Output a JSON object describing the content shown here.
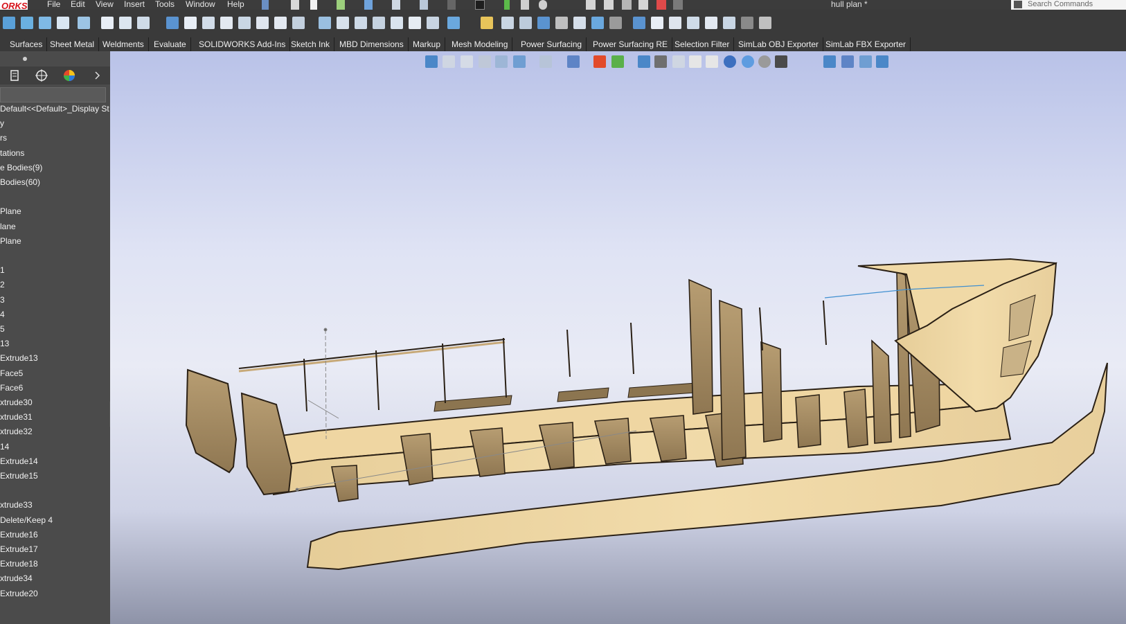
{
  "app": {
    "logo_text": "ORKS",
    "document_title": "hull plan *",
    "search_placeholder": "Search Commands"
  },
  "menu": [
    "File",
    "Edit",
    "View",
    "Insert",
    "Tools",
    "Window",
    "Help"
  ],
  "tabs": [
    "Surfaces",
    "Sheet Metal",
    "Weldments",
    "Evaluate",
    "SOLIDWORKS Add-Ins",
    "Sketch Ink",
    "MBD Dimensions",
    "Markup",
    "Mesh Modeling",
    "Power Surfacing",
    "Power Surfacing RE",
    "Selection Filter",
    "SimLab OBJ Exporter",
    "SimLab FBX Exporter"
  ],
  "feature_tree": [
    "Default<<Default>_Display St",
    "y",
    "rs",
    "tations",
    "e Bodies(9)",
    "Bodies(60)",
    "",
    "Plane",
    "lane",
    "Plane",
    "",
    "1",
    "2",
    "3",
    "4",
    "5",
    "13",
    "Extrude13",
    "Face5",
    "Face6",
    "xtrude30",
    "xtrude31",
    "xtrude32",
    "14",
    "Extrude14",
    "Extrude15",
    "",
    "xtrude33",
    "Delete/Keep 4",
    "Extrude16",
    "Extrude17",
    "Extrude18",
    "xtrude34",
    "Extrude20"
  ],
  "colors": {
    "wood_light": "#f0d9a6",
    "wood_dark": "#a88f66",
    "edge": "#2a2015",
    "accent_red": "#d6121a"
  },
  "icons": {
    "title_quick": [
      "home-icon",
      "new-doc-icon",
      "open-icon",
      "save-icon",
      "print-icon",
      "undo-icon",
      "redo-icon",
      "select-icon",
      "rebuild-icon",
      "file-props-icon",
      "options-icon"
    ],
    "heads_up": [
      "zoom-to-fit-icon",
      "zoom-area-icon",
      "previous-view-icon",
      "section-view-icon",
      "dynamic-annotation-icon",
      "view-orientation-icon",
      "display-style-icon",
      "hide-show-icon",
      "edit-appearance-icon",
      "apply-scene-icon",
      "view-settings-icon",
      "shadows-icon",
      "ambient-occlusion-icon",
      "perspective-icon",
      "cartoon-icon",
      "camera-icon",
      "realview-icon",
      "environment-icon",
      "decal-icon",
      "layout-single-icon",
      "layout-two-icon",
      "layout-horizontal-icon",
      "layout-four-icon"
    ]
  }
}
